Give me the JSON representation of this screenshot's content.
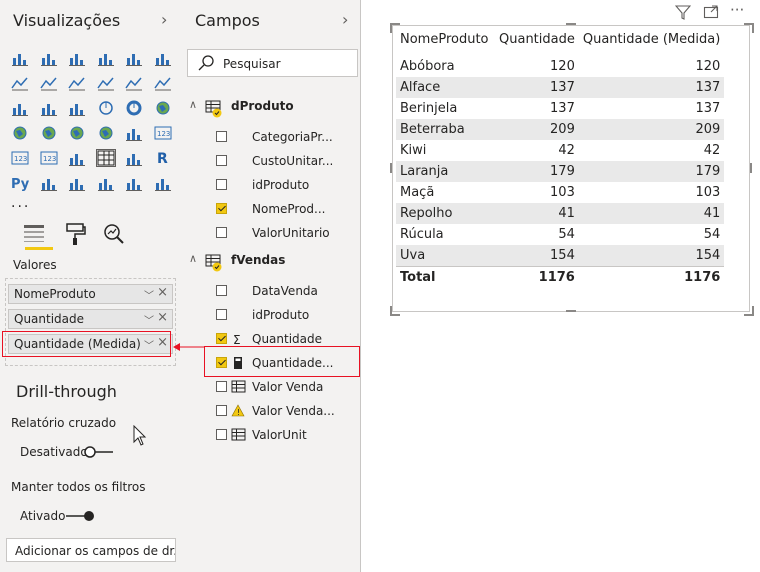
{
  "viz_pane": {
    "title": "Visualizações",
    "more": "...",
    "values_label": "Valores",
    "wells": [
      {
        "label": "NomeProduto"
      },
      {
        "label": "Quantidade"
      },
      {
        "label": "Quantidade (Medida)"
      }
    ],
    "drillthrough": {
      "title": "Drill-through",
      "cross_report_label": "Relatório cruzado",
      "cross_report_state": "Desativado",
      "keep_filters_label": "Manter todos os filtros",
      "keep_filters_state": "Ativado",
      "add_fields": "Adicionar os campos de dr..."
    }
  },
  "fields_pane": {
    "title": "Campos",
    "search_placeholder": "Pesquisar",
    "tables": [
      {
        "name": "dProduto",
        "fields": [
          {
            "label": "CategoriaPr...",
            "checked": false
          },
          {
            "label": "CustoUnitar...",
            "checked": false
          },
          {
            "label": "idProduto",
            "checked": false
          },
          {
            "label": "NomeProd...",
            "checked": true
          },
          {
            "label": "ValorUnitario",
            "checked": false
          }
        ]
      },
      {
        "name": "fVendas",
        "fields": [
          {
            "label": "DataVenda",
            "checked": false
          },
          {
            "label": "idProduto",
            "checked": false
          },
          {
            "label": "Quantidade",
            "checked": true
          },
          {
            "label": "Quantidade...",
            "checked": true
          },
          {
            "label": "Valor Venda",
            "checked": false
          },
          {
            "label": "Valor Venda...",
            "checked": false
          },
          {
            "label": "ValorUnit",
            "checked": false
          }
        ]
      }
    ]
  },
  "visual": {
    "headers": [
      "NomeProduto",
      "Quantidade",
      "Quantidade (Medida)"
    ],
    "rows": [
      [
        "Abóbora",
        "120",
        "120"
      ],
      [
        "Alface",
        "137",
        "137"
      ],
      [
        "Berinjela",
        "137",
        "137"
      ],
      [
        "Beterraba",
        "209",
        "209"
      ],
      [
        "Kiwi",
        "42",
        "42"
      ],
      [
        "Laranja",
        "179",
        "179"
      ],
      [
        "Maçã",
        "103",
        "103"
      ],
      [
        "Repolho",
        "41",
        "41"
      ],
      [
        "Rúcula",
        "54",
        "54"
      ],
      [
        "Uva",
        "154",
        "154"
      ]
    ],
    "total": [
      "Total",
      "1176",
      "1176"
    ],
    "toolbar_more": "···"
  },
  "colors": {
    "accent_yellow": "#f2c811",
    "highlight_red": "#e81123",
    "pane_bg": "#f3f2f1",
    "row_alt": "#e9e9e9"
  }
}
